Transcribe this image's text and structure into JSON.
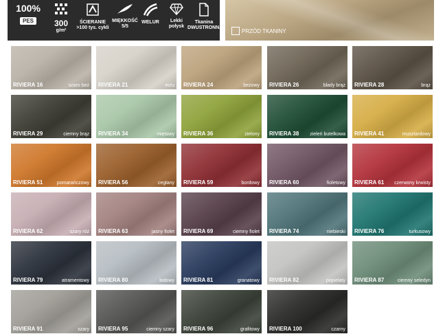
{
  "features": [
    {
      "icon": "pes-icon",
      "big": "100%",
      "small": "PES"
    },
    {
      "icon": "weave-icon",
      "big": "300",
      "small": "g/m²"
    },
    {
      "icon": "abrasion-icon",
      "label": "ŚCIERANIE >100 tys. cykli"
    },
    {
      "icon": "feather-icon",
      "label": "MIĘKKOŚĆ 5/5"
    },
    {
      "icon": "velvet-icon",
      "label": "WELUR"
    },
    {
      "icon": "diamond-icon",
      "label": "Lekki połysk"
    },
    {
      "icon": "document-icon",
      "label": "Tkanina DWUSTRONNA"
    }
  ],
  "photo_label": "PRZÓD TKANINY",
  "swatches": [
    {
      "code": "RIVIERA 16",
      "name": "szaro beż",
      "color": "#b9b2a7"
    },
    {
      "code": "RIVIERA 21",
      "name": "ecru",
      "color": "#d6d2c9"
    },
    {
      "code": "RIVIERA 24",
      "name": "beżowy",
      "color": "#bca27c"
    },
    {
      "code": "RIVIERA 26",
      "name": "blady brąz",
      "color": "#6e6556"
    },
    {
      "code": "RIVIERA 28",
      "name": "brąz",
      "color": "#5b5145"
    },
    {
      "code": "RIVIERA 29",
      "name": "ciemny brąz",
      "color": "#3e3e35"
    },
    {
      "code": "RIVIERA 34",
      "name": "miętowy",
      "color": "#a9c7a8"
    },
    {
      "code": "RIVIERA 36",
      "name": "zielony",
      "color": "#8ea23a"
    },
    {
      "code": "RIVIERA 38",
      "name": "zieleń butelkowa",
      "color": "#1f4d35"
    },
    {
      "code": "RIVIERA 41",
      "name": "musztardowy",
      "color": "#d6ad45"
    },
    {
      "code": "RIVIERA 51",
      "name": "pomarańczowy",
      "color": "#cf772a"
    },
    {
      "code": "RIVIERA 56",
      "name": "cegłany",
      "color": "#9b5f2b"
    },
    {
      "code": "RIVIERA 59",
      "name": "bordowy",
      "color": "#8f2f34"
    },
    {
      "code": "RIVIERA 60",
      "name": "fioletowy",
      "color": "#705563"
    },
    {
      "code": "RIVIERA 61",
      "name": "czerwony krwisty",
      "color": "#b3323b"
    },
    {
      "code": "RIVIERA 62",
      "name": "szary róż",
      "color": "#c7aeb3"
    },
    {
      "code": "RIVIERA 63",
      "name": "jasny fiolet",
      "color": "#a2817f"
    },
    {
      "code": "RIVIERA 69",
      "name": "ciemny fiolet",
      "color": "#573f49"
    },
    {
      "code": "RIVIERA 74",
      "name": "niebieski",
      "color": "#4f7479"
    },
    {
      "code": "RIVIERA 76",
      "name": "turkusowy",
      "color": "#1f7570"
    },
    {
      "code": "RIVIERA 79",
      "name": "atramentowy",
      "color": "#2b313b"
    },
    {
      "code": "RIVIERA 80",
      "name": "lodowy",
      "color": "#b6bdc2"
    },
    {
      "code": "RIVIERA 81",
      "name": "granatowy",
      "color": "#283a5c"
    },
    {
      "code": "RIVIERA 82",
      "name": "popielaty",
      "color": "#c3c3c1"
    },
    {
      "code": "RIVIERA 87",
      "name": "ciemny seledyn",
      "color": "#6d8c78"
    },
    {
      "code": "RIVIERA 91",
      "name": "szary",
      "color": "#a19e98"
    },
    {
      "code": "RIVIERA 95",
      "name": "ciemny szary",
      "color": "#545453"
    },
    {
      "code": "RIVIERA 96",
      "name": "grafitowy",
      "color": "#3b4238"
    },
    {
      "code": "RIVIERA 100",
      "name": "czarny",
      "color": "#2a2a29"
    }
  ]
}
